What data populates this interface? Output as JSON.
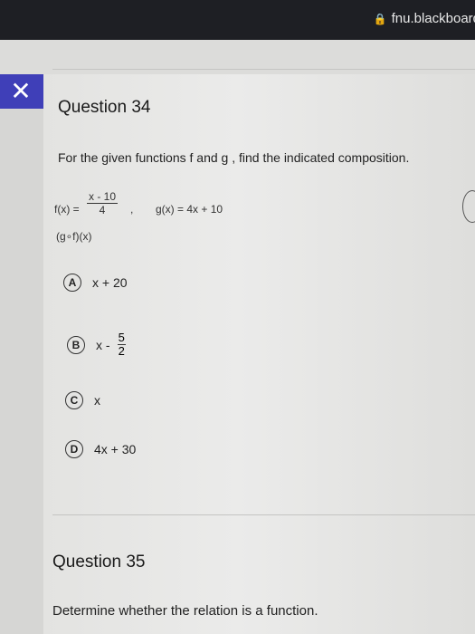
{
  "browser": {
    "url": "fnu.blackboard"
  },
  "q34": {
    "title": "Question 34",
    "prompt": "For the given functions f and g , find the indicated composition.",
    "f_label": "f(x) =",
    "f_num": "x - 10",
    "f_den": "4",
    "f_sep": ",",
    "g_def": "g(x) = 4x + 10",
    "composition": "(g∘f)(x)",
    "options": [
      {
        "letter": "A",
        "text": "x + 20"
      },
      {
        "letter": "B",
        "text": "x -",
        "frac_num": "5",
        "frac_den": "2"
      },
      {
        "letter": "C",
        "text": "x"
      },
      {
        "letter": "D",
        "text": "4x + 30"
      }
    ]
  },
  "q35": {
    "title": "Question 35",
    "prompt": "Determine whether the relation is a function."
  }
}
